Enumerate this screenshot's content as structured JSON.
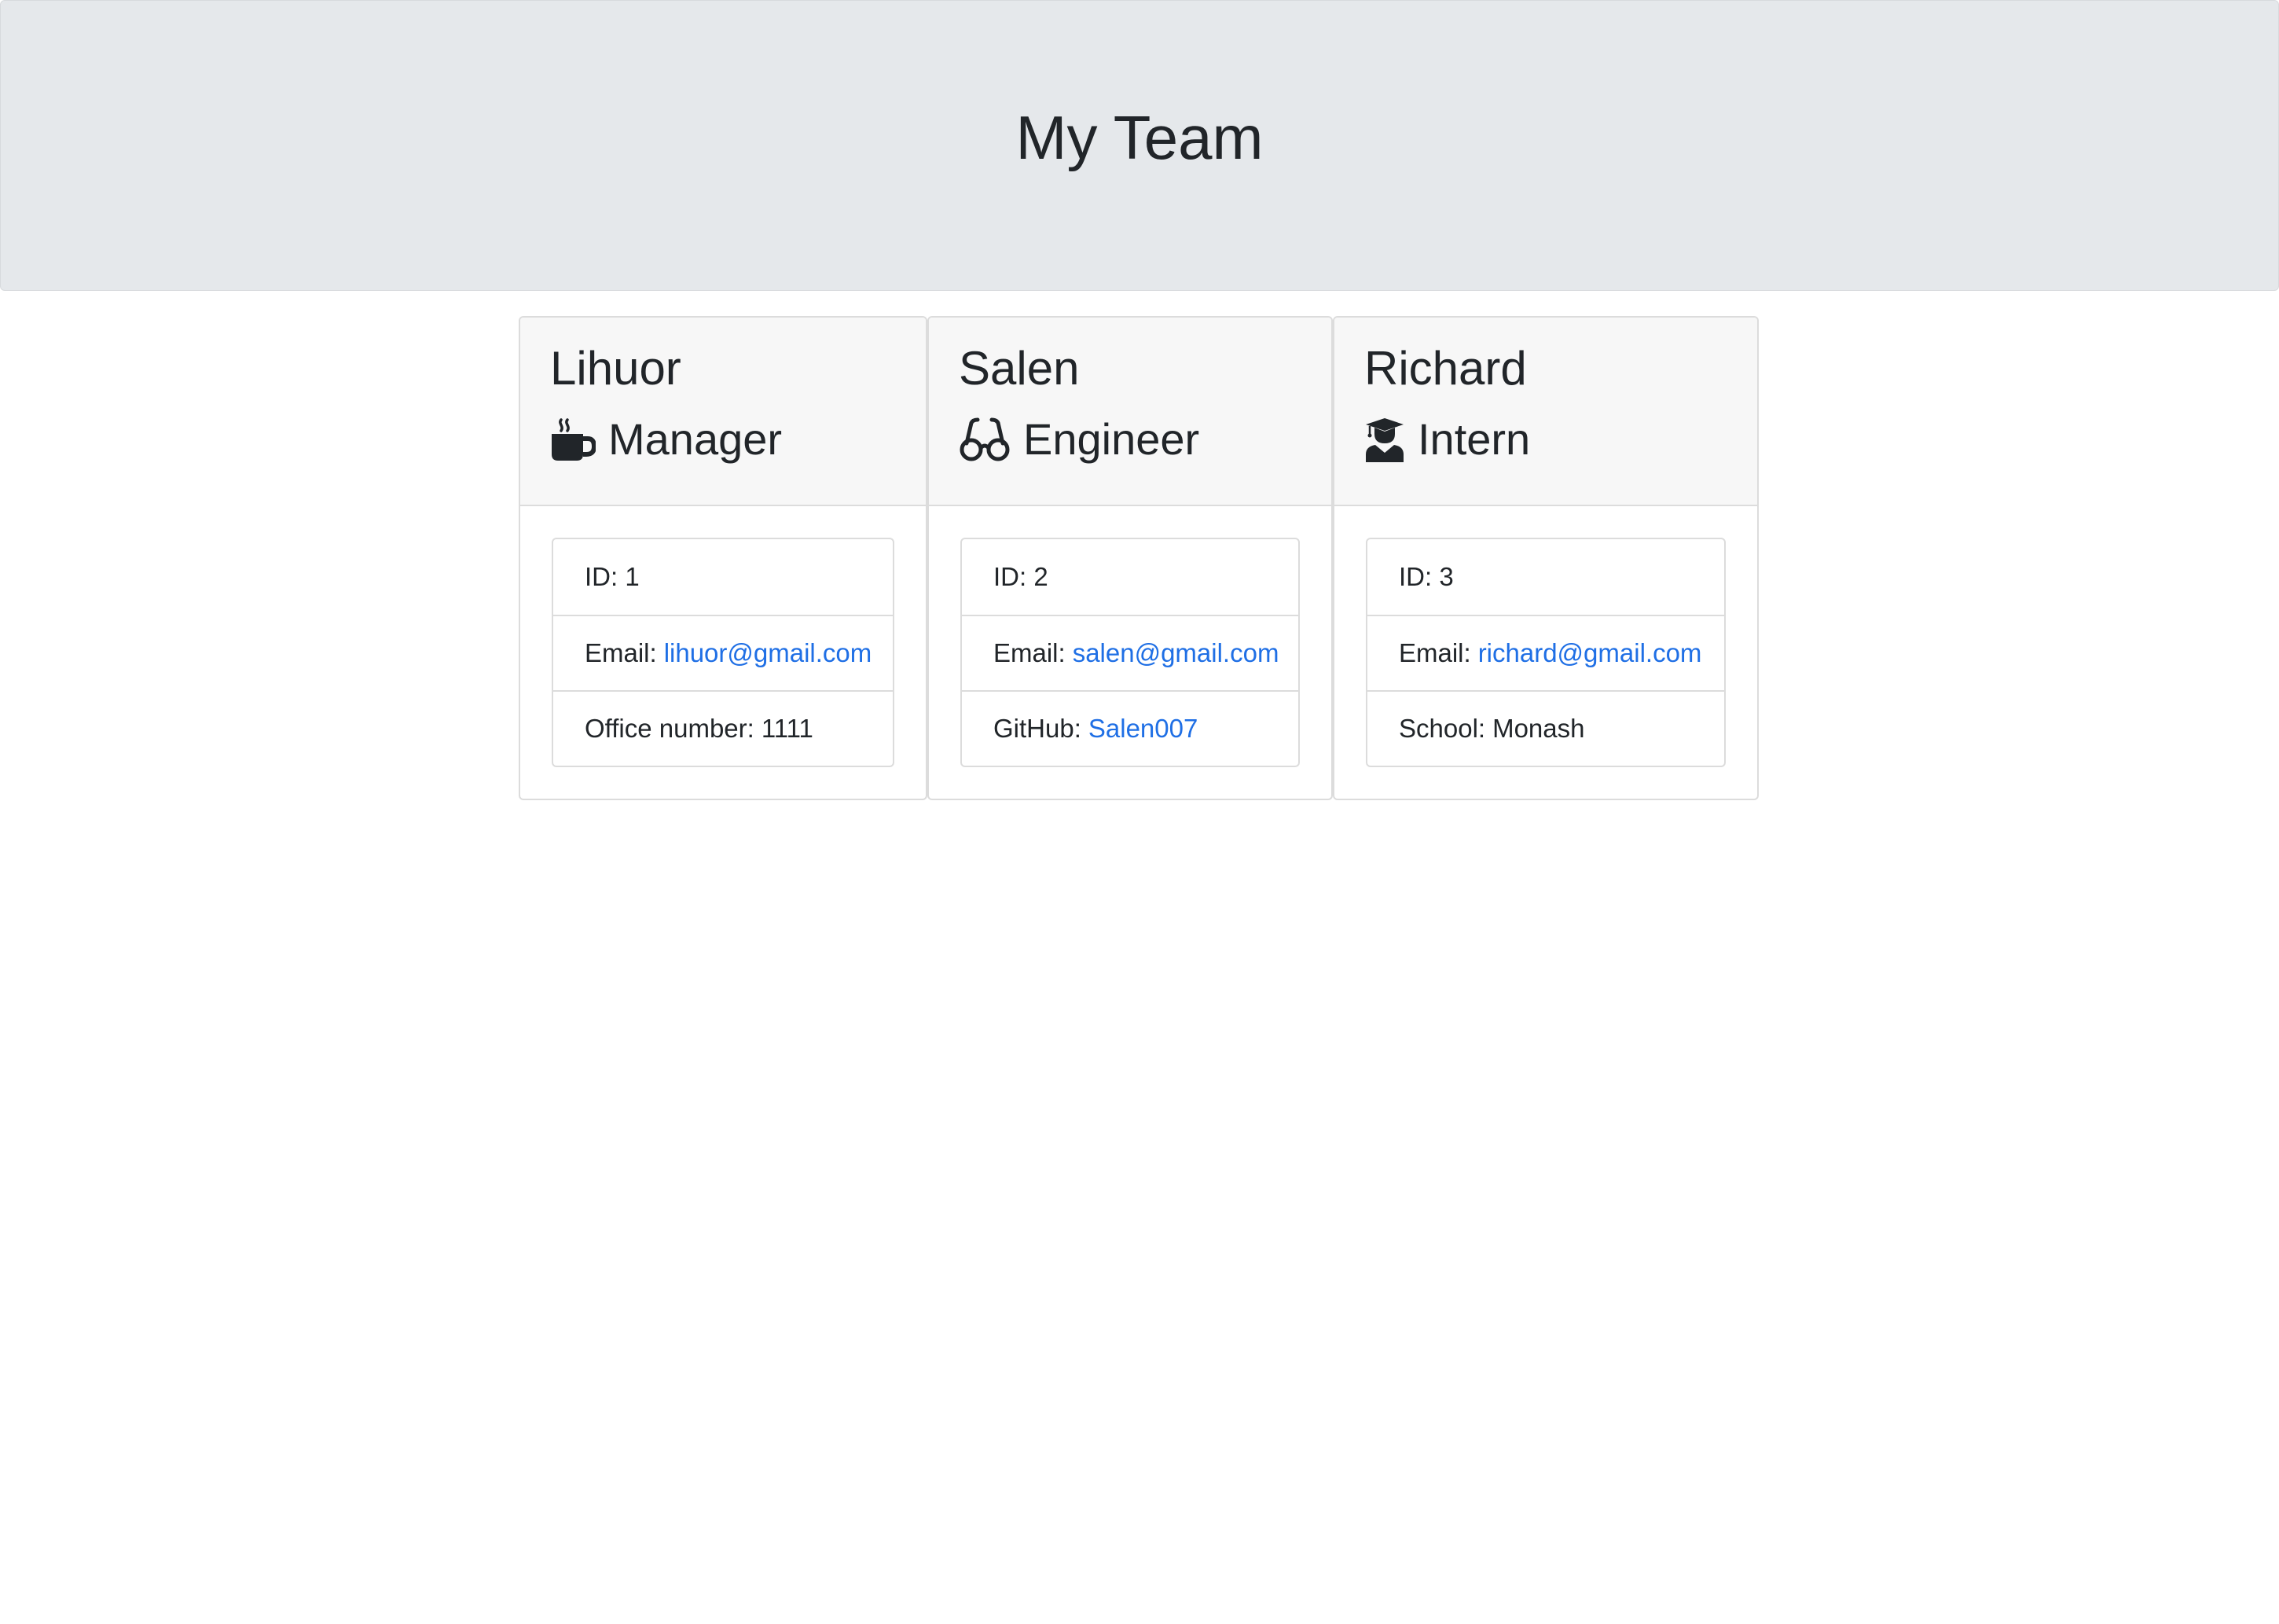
{
  "header": {
    "title": "My Team"
  },
  "cards": [
    {
      "name": "Lihuor",
      "role": "Manager",
      "icon": "coffee-icon",
      "id_label": "ID: 1",
      "email_label": "Email:",
      "email": "lihuor@gmail.com",
      "extra_label": "Office number:",
      "extra_value": "1111"
    },
    {
      "name": "Salen",
      "role": "Engineer",
      "icon": "glasses-icon",
      "id_label": "ID: 2",
      "email_label": "Email:",
      "email": "salen@gmail.com",
      "extra_label": "GitHub:",
      "extra_value": "Salen007"
    },
    {
      "name": "Richard",
      "role": "Intern",
      "icon": "graduate-icon",
      "id_label": "ID: 3",
      "email_label": "Email:",
      "email": "richard@gmail.com",
      "extra_label": "School:",
      "extra_value": "Monash"
    }
  ],
  "colors": {
    "header_bg": "#e5e8eb",
    "card_header_bg": "#f7f7f7",
    "link": "#1f6fe5",
    "text": "#212529",
    "border": "#dcdcdc"
  }
}
